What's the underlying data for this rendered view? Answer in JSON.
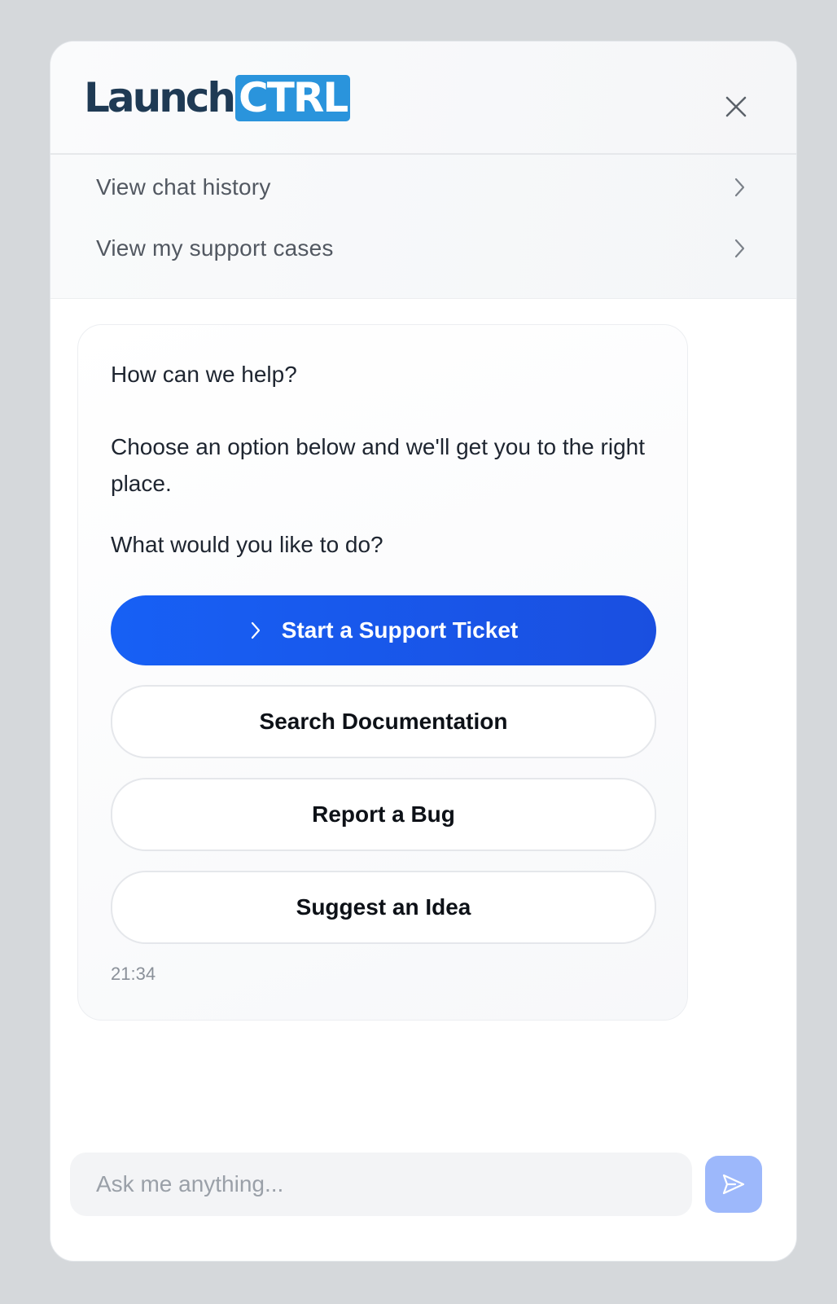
{
  "header": {
    "logo_word": "Launch",
    "logo_box": "CTRL",
    "close_icon": "close-icon"
  },
  "nav": {
    "items": [
      {
        "label": "View chat history",
        "icon": "chevron-right-icon"
      },
      {
        "label": "View my support cases",
        "icon": "chevron-right-icon"
      }
    ]
  },
  "message": {
    "heading": "How can we help?",
    "body": "Choose an option below and we'll get you to the right place.",
    "question": "What would you like to do?",
    "timestamp": "21:34"
  },
  "options": {
    "primary": {
      "label": "Start a Support Ticket",
      "icon": "chevron-right-icon"
    },
    "search_docs": "Search Documentation",
    "report_bug": "Report a Bug",
    "suggest_idea": "Suggest an Idea"
  },
  "composer": {
    "placeholder": "Ask me anything...",
    "value": "",
    "send_icon": "send-icon"
  },
  "colors": {
    "brand_dark": "#1f3a54",
    "brand_blue": "#2a94dc",
    "primary_button": "#1760f5",
    "send_button": "#9db8fb",
    "page_background": "#d5d8db"
  }
}
